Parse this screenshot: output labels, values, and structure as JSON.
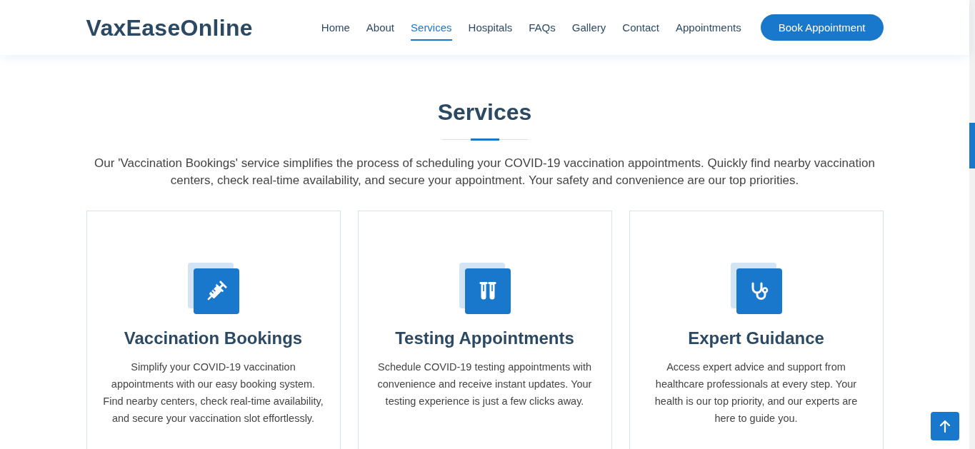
{
  "header": {
    "logo": "VaxEaseOnline",
    "nav": [
      {
        "label": "Home",
        "selected": false
      },
      {
        "label": "About",
        "selected": false
      },
      {
        "label": "Services",
        "selected": true
      },
      {
        "label": "Hospitals",
        "selected": false
      },
      {
        "label": "FAQs",
        "selected": false
      },
      {
        "label": "Gallery",
        "selected": false
      },
      {
        "label": "Contact",
        "selected": false
      },
      {
        "label": "Appointments",
        "selected": false
      }
    ],
    "button": "Book Appointment"
  },
  "section": {
    "title": "Services",
    "intro": "Our 'Vaccination Bookings' service simplifies the process of scheduling your COVID-19 vaccination appointments. Quickly find nearby vaccination centers, check real-time availability, and secure your appointment. Your safety and convenience are our top priorities.",
    "cards": [
      {
        "kind": "syringe",
        "title": "Vaccination Bookings",
        "text": "Simplify your COVID-19 vaccination appointments with our easy booking system. Find nearby centers, check real-time availability, and secure your vaccination slot effortlessly."
      },
      {
        "kind": "test-tubes",
        "title": "Testing Appointments",
        "text": "Schedule COVID-19 testing appointments with convenience and receive instant updates. Your testing experience is just a few clicks away."
      },
      {
        "kind": "stethoscope",
        "title": "Expert Guidance",
        "text": "Access expert advice and support from healthcare professionals at every step. Your health is our top priority, and our experts are here to guide you."
      }
    ]
  }
}
